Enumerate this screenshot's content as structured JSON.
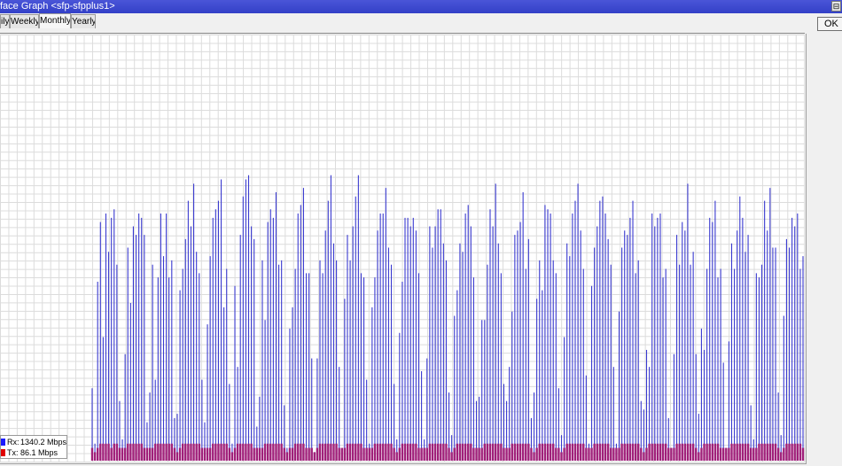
{
  "window": {
    "title": "face Graph <sfp-sfpplus1>",
    "control_glyph": "⊟"
  },
  "tabs": [
    {
      "label": "ily",
      "active": false
    },
    {
      "label": "Weekly",
      "active": false
    },
    {
      "label": "Monthly",
      "active": true
    },
    {
      "label": "Yearly",
      "active": false
    }
  ],
  "ok_label": "OK",
  "legend": {
    "rx": {
      "label": "Rx:",
      "value": "1340.2 Mbps",
      "color": "#1a1aff"
    },
    "tx": {
      "label": "Tx:",
      "value": "86.1 Mbps",
      "color": "#e00000"
    }
  },
  "chart_data": {
    "type": "bar",
    "description_grid": true,
    "ylim": [
      0,
      100
    ],
    "series": [
      {
        "values": [
          17,
          4,
          42,
          56,
          29,
          58,
          49,
          57,
          59,
          46,
          14,
          5,
          25,
          50,
          37,
          55,
          53,
          58,
          57,
          53,
          9,
          16,
          46,
          19,
          43,
          58,
          48,
          58,
          43,
          47,
          10,
          11,
          40,
          45,
          52,
          61,
          55,
          65,
          49,
          44,
          19,
          9,
          32,
          48,
          57,
          59,
          61,
          66,
          36,
          45,
          18,
          4,
          41,
          22,
          53,
          62,
          66,
          67,
          55,
          52,
          8,
          15,
          47,
          33,
          56,
          59,
          57,
          63,
          46,
          47,
          13,
          3,
          31,
          36,
          45,
          58,
          60,
          64,
          44,
          44,
          24,
          2,
          24,
          47,
          44,
          54,
          61,
          67,
          51,
          47,
          22,
          2,
          38,
          53,
          47,
          55,
          62,
          67,
          44,
          43,
          19,
          4,
          36,
          43,
          54,
          58,
          58,
          64,
          50,
          46,
          18,
          5,
          30,
          42,
          57,
          57,
          55,
          57,
          54,
          44,
          21,
          5,
          24,
          55,
          50,
          55,
          59,
          59,
          51,
          47,
          16,
          6,
          34,
          40,
          51,
          49,
          58,
          60,
          55,
          43,
          14,
          15,
          33,
          33,
          46,
          59,
          55,
          65,
          51,
          44,
          18,
          14,
          22,
          35,
          53,
          54,
          56,
          63,
          45,
          52,
          10,
          16,
          38,
          47,
          40,
          60,
          59,
          58,
          47,
          44,
          17,
          6,
          29,
          51,
          48,
          58,
          61,
          65,
          54,
          45,
          20,
          4,
          41,
          50,
          55,
          61,
          62,
          58,
          52,
          46,
          22,
          4,
          35,
          50,
          54,
          53,
          57,
          61,
          44,
          47,
          14,
          12,
          26,
          22,
          58,
          55,
          57,
          58,
          43,
          45,
          10,
          3,
          25,
          53,
          46,
          56,
          54,
          65,
          46,
          49,
          25,
          11,
          31,
          26,
          45,
          57,
          56,
          61,
          43,
          45,
          23,
          3,
          28,
          51,
          45,
          54,
          62,
          57,
          49,
          53,
          13,
          5,
          44,
          43,
          46,
          61,
          54,
          64,
          50,
          50,
          16,
          6,
          34,
          52,
          50,
          57,
          55,
          58,
          45,
          48
        ]
      },
      {
        "values": [
          3,
          2,
          3,
          4,
          4,
          4,
          4,
          3,
          4,
          4,
          3,
          3,
          3,
          4,
          4,
          4,
          4,
          4,
          4,
          3,
          3,
          3,
          3,
          4,
          4,
          4,
          4,
          4,
          4,
          4,
          3,
          2,
          3,
          4,
          4,
          4,
          4,
          4,
          4,
          4,
          3,
          3,
          3,
          3,
          4,
          4,
          4,
          4,
          4,
          4,
          3,
          2,
          3,
          4,
          4,
          4,
          4,
          4,
          4,
          3,
          3,
          3,
          3,
          4,
          4,
          4,
          4,
          4,
          4,
          4,
          3,
          2,
          3,
          3,
          4,
          4,
          4,
          4,
          3,
          3,
          3,
          2,
          3,
          4,
          4,
          4,
          4,
          4,
          4,
          4,
          3,
          3,
          3,
          4,
          4,
          4,
          4,
          4,
          4,
          3,
          3,
          3,
          3,
          4,
          4,
          4,
          4,
          4,
          4,
          4,
          3,
          2,
          3,
          4,
          4,
          4,
          4,
          4,
          4,
          3,
          3,
          3,
          3,
          4,
          4,
          4,
          4,
          4,
          4,
          4,
          3,
          2,
          3,
          4,
          4,
          4,
          4,
          4,
          4,
          3,
          3,
          3,
          3,
          4,
          4,
          4,
          4,
          4,
          4,
          4,
          3,
          3,
          3,
          4,
          4,
          4,
          4,
          4,
          4,
          4,
          3,
          2,
          3,
          4,
          4,
          4,
          4,
          4,
          4,
          3,
          3,
          2,
          3,
          4,
          4,
          4,
          4,
          4,
          4,
          4,
          3,
          3,
          3,
          4,
          4,
          4,
          4,
          4,
          4,
          3,
          3,
          3,
          3,
          4,
          4,
          4,
          4,
          4,
          4,
          4,
          3,
          2,
          3,
          4,
          4,
          4,
          4,
          4,
          4,
          4,
          3,
          3,
          3,
          4,
          4,
          4,
          4,
          4,
          4,
          4,
          3,
          2,
          3,
          4,
          4,
          4,
          4,
          4,
          4,
          3,
          3,
          3,
          3,
          4,
          4,
          4,
          4,
          4,
          4,
          4,
          3,
          3,
          3,
          4,
          4,
          4,
          4,
          4,
          4,
          4,
          3,
          2,
          3,
          4,
          4,
          4,
          4,
          4,
          4,
          3
        ]
      }
    ]
  }
}
